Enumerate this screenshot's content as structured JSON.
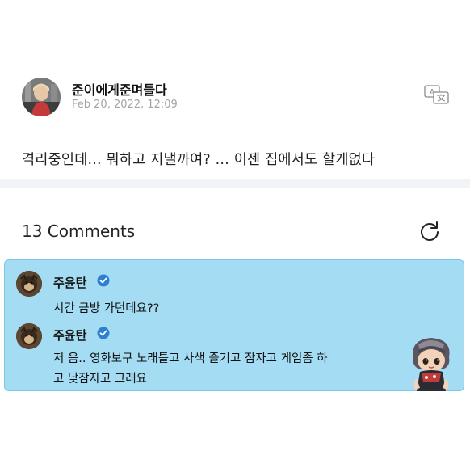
{
  "post": {
    "author": "준이에게준며들다",
    "date": "Feb 20, 2022, 12:09",
    "body": "격리중인데... 뭐하고 지낼까여? ... 이젠 집에서도 할게없다",
    "translate_icon": "translate-icon"
  },
  "comments": {
    "title": "13 Comments",
    "refresh_icon": "refresh-icon",
    "items": [
      {
        "author": "주윤탄",
        "verified": true,
        "lines": [
          "시간 금방 가던데요??"
        ]
      },
      {
        "author": "주윤탄",
        "verified": true,
        "lines": [
          "저 음.. 영화보구 노래틀고 사색 즐기고 잠자고 게임좀 하",
          "고 낮잠자고 그래요"
        ]
      }
    ]
  },
  "colors": {
    "highlight_bg": "#a4dcf3",
    "verified_badge": "#2f7fd1"
  }
}
